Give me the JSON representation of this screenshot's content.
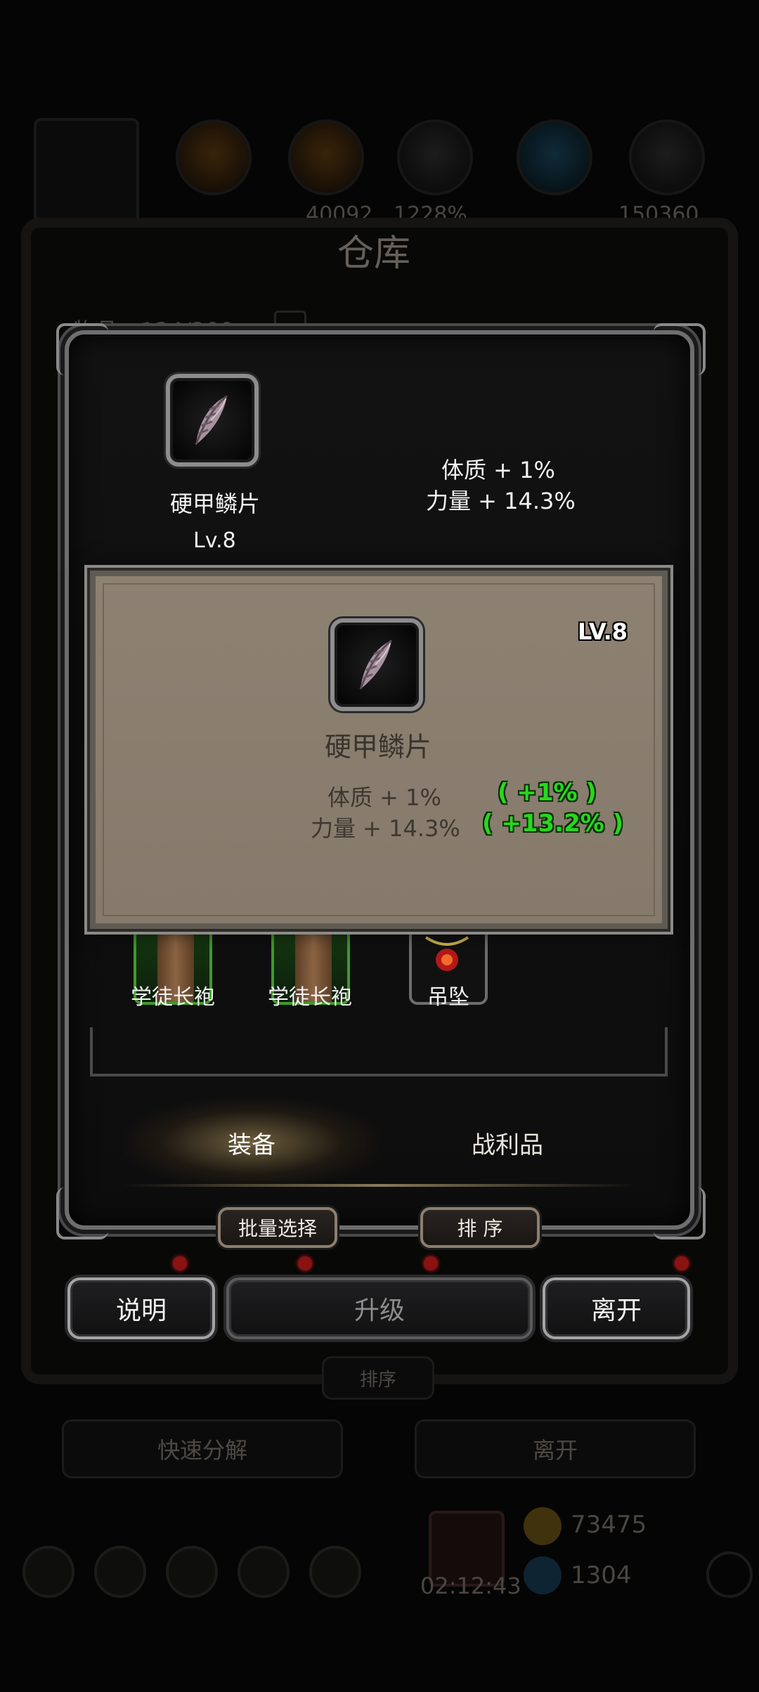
{
  "background": {
    "title": "仓库",
    "item_count": "物品：124/200",
    "res_values": [
      "40092",
      "1228%",
      "150360"
    ],
    "sort_label": "排序",
    "quick_dismantle_label": "快速分解",
    "leave_label": "离开",
    "timer": "02:12:43",
    "gold": "73475",
    "gems": "1304"
  },
  "item": {
    "name": "硬甲鳞片",
    "level": "Lv.8",
    "stats": [
      "体质 + 1%",
      "力量 + 14.3%"
    ]
  },
  "tooltip": {
    "level": "LV.8",
    "name": "硬甲鳞片",
    "stats": [
      "体质 + 1%",
      "力量 + 14.3%"
    ],
    "bonus": [
      "( +1% )",
      "( +13.2% )"
    ],
    "bonus_color": "#27d81e"
  },
  "inventory": {
    "items": [
      {
        "name": "学徒长袍",
        "rarity_color": "#3f9a2c"
      },
      {
        "name": "学徒长袍",
        "rarity_color": "#3f9a2c"
      },
      {
        "name": "吊坠"
      }
    ]
  },
  "tabs": [
    {
      "label": "装备",
      "active": true
    },
    {
      "label": "战利品",
      "active": false
    }
  ],
  "actions": {
    "batch_select": "批量选择",
    "sort": "排 序",
    "help": "说明",
    "upgrade": "升级",
    "leave": "离开"
  }
}
